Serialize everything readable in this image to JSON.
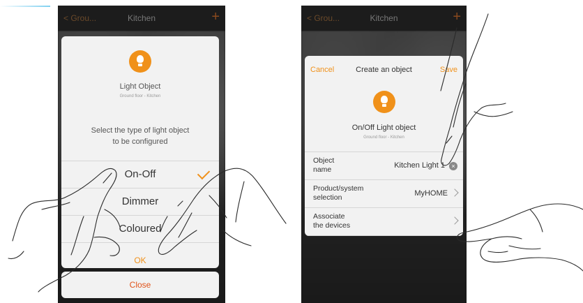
{
  "left_screen": {
    "header": {
      "back": "< Grou...",
      "title": "Kitchen",
      "plus": "+"
    },
    "dialog": {
      "icon": "lightbulb-icon",
      "title": "Light Object",
      "subtitle": "Ground floor - Kitchen",
      "instruction": "Select the type of light object\nto be configured",
      "options": [
        {
          "label": "On-Off",
          "selected": true
        },
        {
          "label": "Dimmer",
          "selected": false
        },
        {
          "label": "Coloured",
          "selected": false
        }
      ],
      "ok_label": "OK"
    },
    "close_label": "Close"
  },
  "right_screen": {
    "header": {
      "back": "< Grou...",
      "title": "Kitchen",
      "plus": "+"
    },
    "dialog": {
      "cancel_label": "Cancel",
      "title": "Create an object",
      "save_label": "Save",
      "icon": "lightbulb-icon",
      "object_type": "On/Off Light object",
      "location": "Ground floor - Kitchen",
      "rows": [
        {
          "label": "Object\nname",
          "value": "Kitchen Light 1"
        },
        {
          "label": "Product/system\nselection",
          "value": "MyHOME"
        },
        {
          "label": "Associate\nthe devices",
          "value": ""
        }
      ]
    }
  },
  "colors": {
    "accent": "#f0911a",
    "close": "#e0531a",
    "dialog_bg": "#f2f2f2",
    "screen_bg": "#141414"
  }
}
